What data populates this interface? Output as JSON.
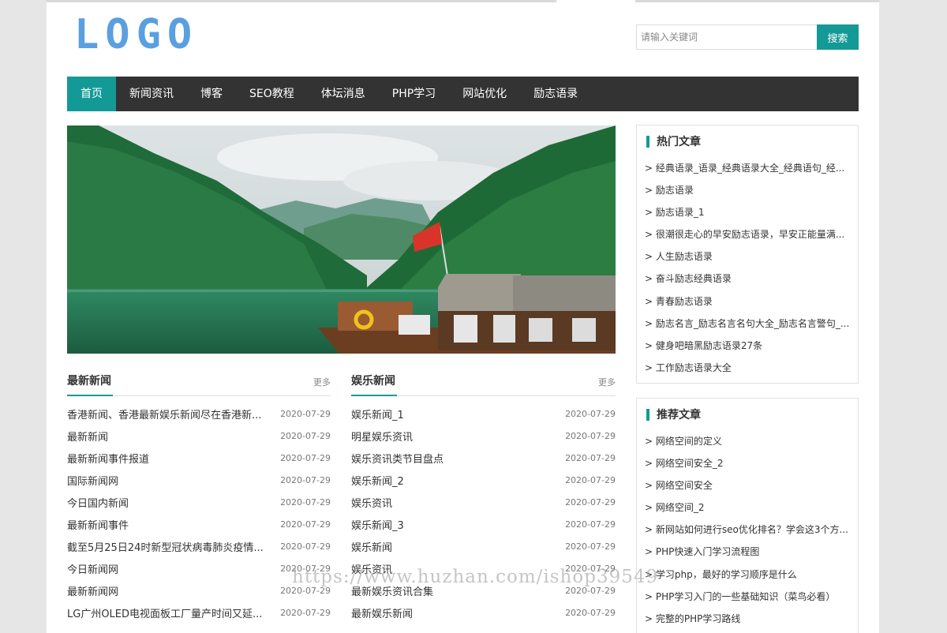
{
  "colors": {
    "accent": "#139a96",
    "nav_bg": "#333333",
    "logo": "#5a9fe0",
    "page_bg": "#e6e6e6"
  },
  "logo": "LOGO",
  "search": {
    "placeholder": "请输入关键词",
    "button": "搜索"
  },
  "nav": [
    {
      "label": "首页",
      "active": true
    },
    {
      "label": "新闻资讯",
      "active": false
    },
    {
      "label": "博客",
      "active": false
    },
    {
      "label": "SEO教程",
      "active": false
    },
    {
      "label": "体坛消息",
      "active": false
    },
    {
      "label": "PHP学习",
      "active": false
    },
    {
      "label": "网站优化",
      "active": false
    },
    {
      "label": "励志语录",
      "active": false
    }
  ],
  "latest_news": {
    "title": "最新新闻",
    "more": "更多",
    "items": [
      {
        "title": "香港新闻、香港最新娱乐新闻尽在香港新...",
        "date": "2020-07-29"
      },
      {
        "title": "最新新闻",
        "date": "2020-07-29"
      },
      {
        "title": "最新新闻事件报道",
        "date": "2020-07-29"
      },
      {
        "title": "国际新闻网",
        "date": "2020-07-29"
      },
      {
        "title": "今日国内新闻",
        "date": "2020-07-29"
      },
      {
        "title": "最新新闻事件",
        "date": "2020-07-29"
      },
      {
        "title": "截至5月25日24时新型冠状病毒肺炎疫情...",
        "date": "2020-07-29"
      },
      {
        "title": "今日新闻网",
        "date": "2020-07-29"
      },
      {
        "title": "最新新闻网",
        "date": "2020-07-29"
      },
      {
        "title": "LG广州OLED电视面板工厂量产时间又延...",
        "date": "2020-07-29"
      }
    ]
  },
  "ent_news": {
    "title": "娱乐新闻",
    "more": "更多",
    "items": [
      {
        "title": "娱乐新闻_1",
        "date": "2020-07-29"
      },
      {
        "title": "明星娱乐资讯",
        "date": "2020-07-29"
      },
      {
        "title": "娱乐资讯类节目盘点",
        "date": "2020-07-29"
      },
      {
        "title": "娱乐新闻_2",
        "date": "2020-07-29"
      },
      {
        "title": "娱乐资讯",
        "date": "2020-07-29"
      },
      {
        "title": "娱乐新闻_3",
        "date": "2020-07-29"
      },
      {
        "title": "娱乐新闻",
        "date": "2020-07-29"
      },
      {
        "title": "娱乐资讯",
        "date": "2020-07-29"
      },
      {
        "title": "最新娱乐资讯合集",
        "date": "2020-07-29"
      },
      {
        "title": "最新娱乐新闻",
        "date": "2020-07-29"
      }
    ]
  },
  "hot": {
    "title": "热门文章",
    "items": [
      "> 经典语录_语录_经典语录大全_经典语句_经...",
      "> 励志语录",
      "> 励志语录_1",
      "> 很潮很走心的早安励志语录，早安正能量满...",
      "> 人生励志语录",
      "> 奋斗励志经典语录",
      "> 青春励志语录",
      "> 励志名言_励志名言名句大全_励志名言警句_...",
      "> 健身吧暗黑励志语录27条",
      "> 工作励志语录大全"
    ]
  },
  "recommend": {
    "title": "推荐文章",
    "items": [
      "> 网络空间的定义",
      "> 网络空间安全_2",
      "> 网络空间安全",
      "> 网络空间_2",
      "> 新网站如何进行seo优化排名？学会这3个方...",
      "> PHP快速入门学习流程图",
      "> 学习php，最好的学习顺序是什么",
      "> PHP学习入门的一些基础知识（菜鸟必看）",
      "> 完整的PHP学习路线"
    ]
  },
  "watermark": "https://www.huzhan.com/ishop39549"
}
